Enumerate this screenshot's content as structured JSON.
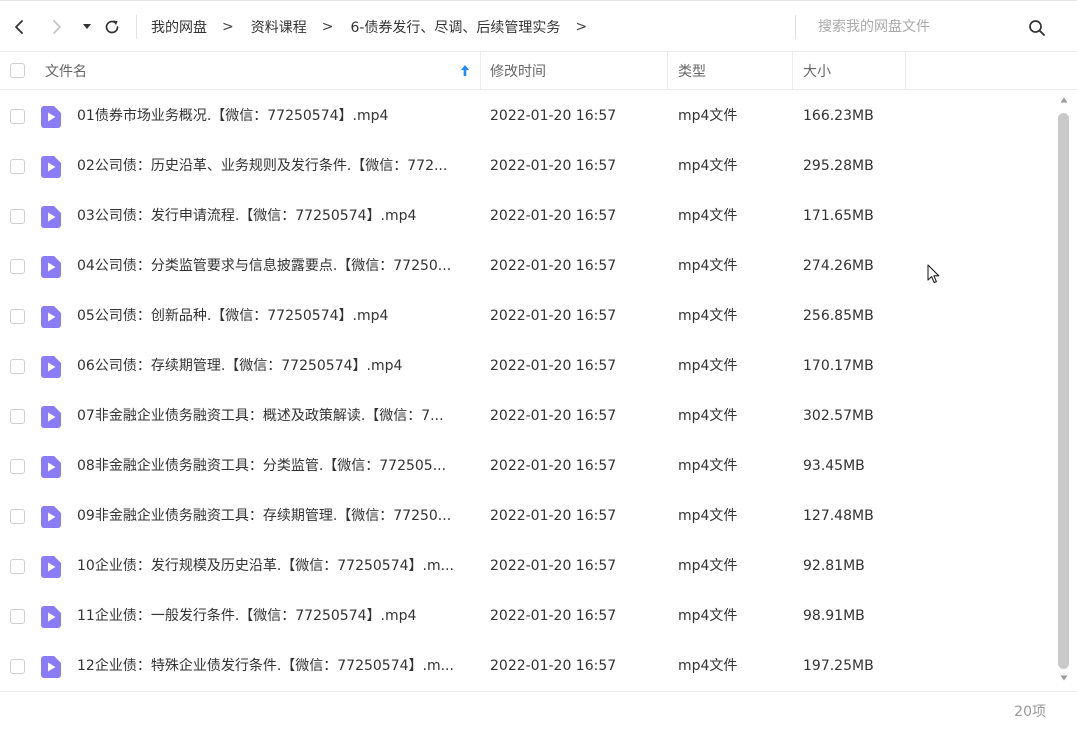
{
  "toolbar": {
    "breadcrumbs": [
      "我的网盘",
      "资料课程",
      "6-债券发行、尽调、后续管理实务"
    ],
    "separator": ">",
    "search_placeholder": "搜索我的网盘文件",
    "icons": {
      "back": "arrow-left-icon",
      "forward": "arrow-right-icon",
      "history": "caret-down-icon",
      "refresh": "refresh-icon",
      "search": "search-icon"
    }
  },
  "header": {
    "name": "文件名",
    "modified": "修改时间",
    "type": "类型",
    "size": "大小",
    "sort_icon": "sort-arrow-up-icon"
  },
  "files": [
    {
      "name": "01债券市场业务概况.【微信：77250574】.mp4",
      "modified": "2022-01-20 16:57",
      "type": "mp4文件",
      "size": "166.23MB"
    },
    {
      "name": "02公司债：历史沿革、业务规则及发行条件.【微信：772...",
      "modified": "2022-01-20 16:57",
      "type": "mp4文件",
      "size": "295.28MB"
    },
    {
      "name": "03公司债：发行申请流程.【微信：77250574】.mp4",
      "modified": "2022-01-20 16:57",
      "type": "mp4文件",
      "size": "171.65MB"
    },
    {
      "name": "04公司债：分类监管要求与信息披露要点.【微信：77250...",
      "modified": "2022-01-20 16:57",
      "type": "mp4文件",
      "size": "274.26MB"
    },
    {
      "name": "05公司债：创新品种.【微信：77250574】.mp4",
      "modified": "2022-01-20 16:57",
      "type": "mp4文件",
      "size": "256.85MB"
    },
    {
      "name": "06公司债：存续期管理.【微信：77250574】.mp4",
      "modified": "2022-01-20 16:57",
      "type": "mp4文件",
      "size": "170.17MB"
    },
    {
      "name": "07非金融企业债务融资工具：概述及政策解读.【微信：7...",
      "modified": "2022-01-20 16:57",
      "type": "mp4文件",
      "size": "302.57MB"
    },
    {
      "name": "08非金融企业债务融资工具：分类监管.【微信：772505...",
      "modified": "2022-01-20 16:57",
      "type": "mp4文件",
      "size": "93.45MB"
    },
    {
      "name": "09非金融企业债务融资工具：存续期管理.【微信：77250...",
      "modified": "2022-01-20 16:57",
      "type": "mp4文件",
      "size": "127.48MB"
    },
    {
      "name": "10企业债：发行规模及历史沿革.【微信：77250574】.m...",
      "modified": "2022-01-20 16:57",
      "type": "mp4文件",
      "size": "92.81MB"
    },
    {
      "name": "11企业债：一般发行条件.【微信：77250574】.mp4",
      "modified": "2022-01-20 16:57",
      "type": "mp4文件",
      "size": "98.91MB"
    },
    {
      "name": "12企业债：特殊企业债发行条件.【微信：77250574】.m...",
      "modified": "2022-01-20 16:57",
      "type": "mp4文件",
      "size": "197.25MB"
    }
  ],
  "file_icon": "video-file-icon",
  "footer": {
    "count": "20项"
  },
  "colors": {
    "accent": "#1a8cff",
    "video_icon": "#8a7cf7"
  }
}
